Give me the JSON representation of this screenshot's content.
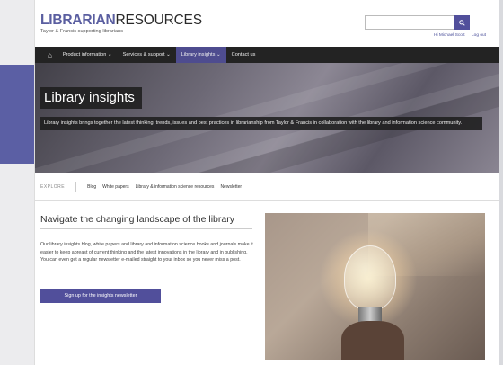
{
  "header": {
    "logo_primary": "LIBRARIAN",
    "logo_secondary": "RESOURCES",
    "tagline": "Taylor & Francis supporting librarians",
    "search_placeholder": "",
    "search_icon": "search-icon",
    "greeting": "Hi Michael Scott",
    "logout": "Log out"
  },
  "nav": {
    "home_icon": "home-icon",
    "items": [
      {
        "label": "Product information ⌄"
      },
      {
        "label": "Services & support ⌄"
      },
      {
        "label": "Library insights ⌄",
        "active": true
      },
      {
        "label": "Contact us"
      }
    ]
  },
  "hero": {
    "title": "Library insights",
    "description": "Library insights brings together the latest thinking, trends, issues and best practices in librarianship from Taylor & Francis in collaboration with the library and information science community."
  },
  "explore": {
    "label": "EXPLORE",
    "links": [
      "Blog",
      "White papers",
      "Library & information science resources",
      "Newsletter"
    ]
  },
  "main": {
    "heading": "Navigate the changing landscape of the library",
    "body": "Our library insights blog, white papers and library and information science books and journals make it easier to keep abreast of current thinking and the latest innovations in the library and in publishing. You can even get a regular newsletter e-mailed straight to your inbox so you never miss a post.",
    "cta_label": "Sign up for the insights newsletter"
  },
  "colors": {
    "accent": "#514f9b",
    "nav_bg": "#232323"
  }
}
